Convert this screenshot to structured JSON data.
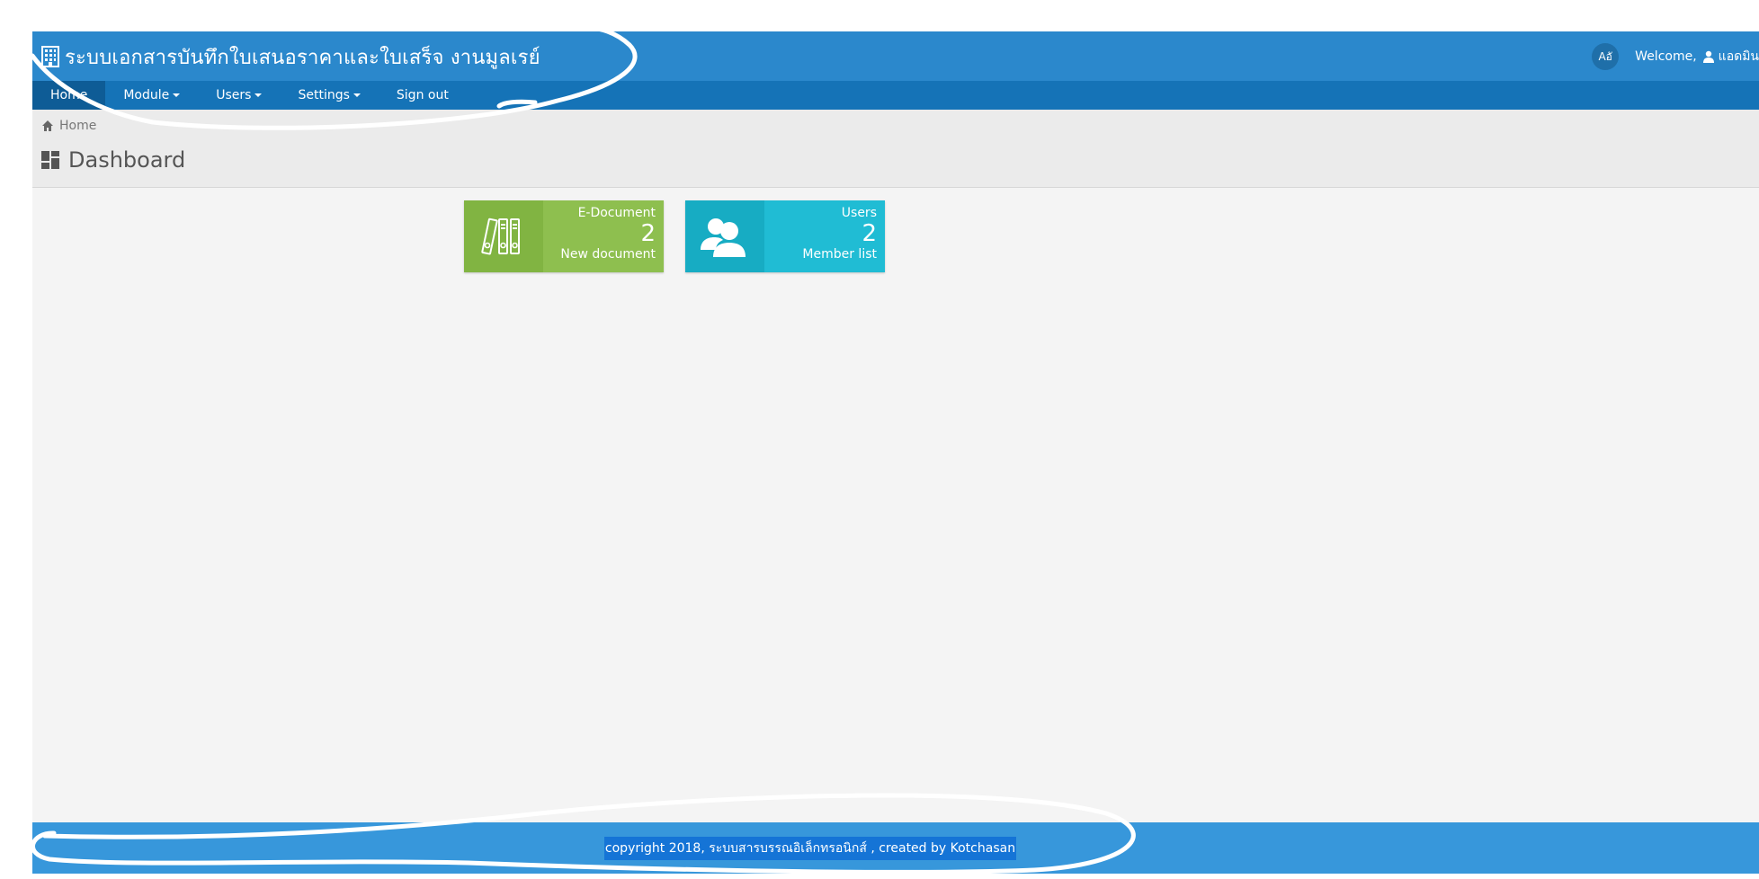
{
  "header": {
    "title": "ระบบเอกสารบันทึกใบเสนอราคาและใบเสร็จ งานมูลเรย์",
    "lang_button": "Aอั",
    "welcome_label": "Welcome,",
    "user_name": "แอดมิน"
  },
  "nav": {
    "items": [
      {
        "label": "Home",
        "active": true
      },
      {
        "label": "Module",
        "dropdown": true
      },
      {
        "label": "Users",
        "dropdown": true
      },
      {
        "label": "Settings",
        "dropdown": true
      },
      {
        "label": "Sign out"
      }
    ]
  },
  "breadcrumb": {
    "home": "Home"
  },
  "page": {
    "title": "Dashboard"
  },
  "cards": [
    {
      "label": "E-Document",
      "value": "2",
      "caption": "New document",
      "color": "#8ebf4f",
      "icon": "binders-icon"
    },
    {
      "label": "Users",
      "value": "2",
      "caption": "Member list",
      "color": "#20bcd4",
      "icon": "users-icon"
    }
  ],
  "footer": {
    "text": "copyright 2018, ระบบสารบรรณอิเล็กทรอนิกส์ , created by Kotchasan"
  },
  "colors": {
    "header": "#2b88cc",
    "nav": "#1573b7",
    "footer": "#3797db"
  }
}
